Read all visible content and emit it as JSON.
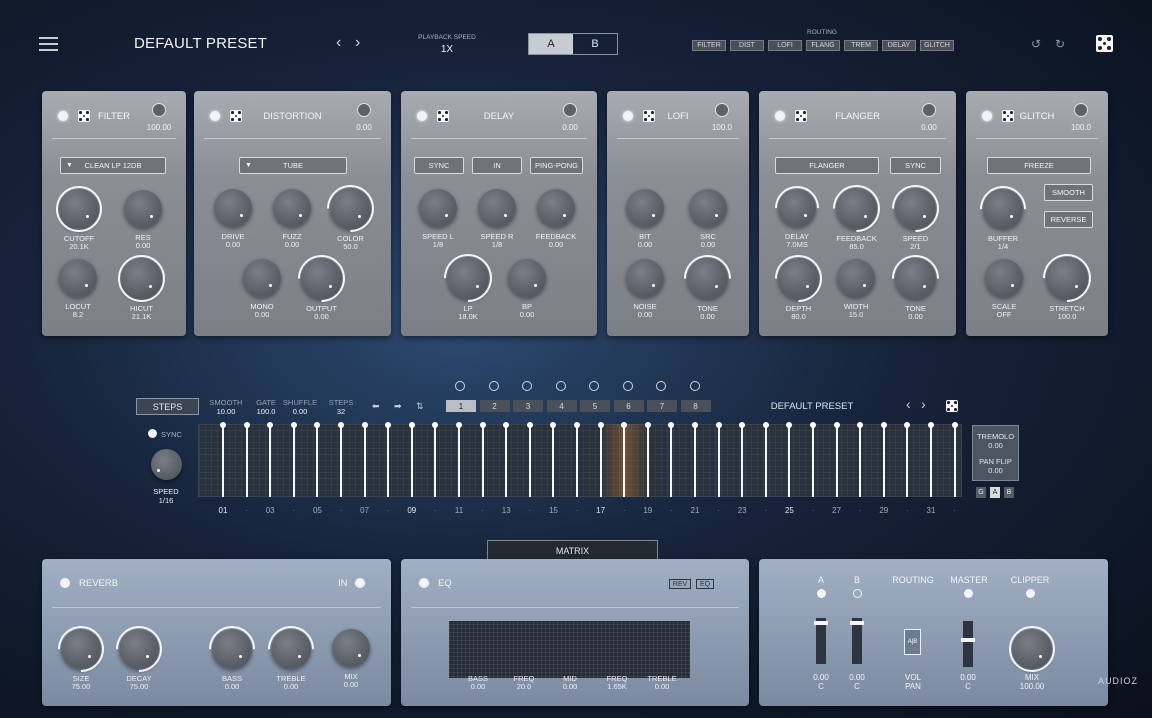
{
  "header": {
    "title": "DEFAULT PRESET",
    "playback_label": "PLAYBACK SPEED",
    "playback_value": "1X",
    "ab": [
      "A",
      "B"
    ],
    "routing_label": "ROUTING",
    "routing": [
      "FILTER",
      "DIST",
      "LOFI",
      "FLANG",
      "TREM",
      "DELAY",
      "GLITCH"
    ]
  },
  "filter": {
    "name": "FILTER",
    "mini": "100.00",
    "dropdown": "CLEAN LP 12DB",
    "knobs": [
      {
        "l": "CUTOFF",
        "v": "20.1K"
      },
      {
        "l": "RES",
        "v": "0.00"
      },
      {
        "l": "LOCUT",
        "v": "8.2"
      },
      {
        "l": "HICUT",
        "v": "21.1K"
      }
    ]
  },
  "distortion": {
    "name": "DISTORTION",
    "mini": "0.00",
    "dropdown": "TUBE",
    "knobs": [
      {
        "l": "DRIVE",
        "v": "0.00"
      },
      {
        "l": "FUZZ",
        "v": "0.00"
      },
      {
        "l": "COLOR",
        "v": "50.0"
      },
      {
        "l": "MONO",
        "v": "0.00"
      },
      {
        "l": "OUTPUT",
        "v": "0.00"
      }
    ]
  },
  "delay": {
    "name": "DELAY",
    "mini": "0.00",
    "buttons": [
      "SYNC",
      "IN",
      "PING-PONG"
    ],
    "knobs": [
      {
        "l": "SPEED L",
        "v": "1/8"
      },
      {
        "l": "SPEED R",
        "v": "1/8"
      },
      {
        "l": "FEEDBACK",
        "v": "0.00"
      },
      {
        "l": "LP",
        "v": "18.0K"
      },
      {
        "l": "BP",
        "v": "0.00"
      }
    ]
  },
  "lofi": {
    "name": "LOFI",
    "mini": "100.0",
    "knobs": [
      {
        "l": "BIT",
        "v": "0.00"
      },
      {
        "l": "SRC",
        "v": "0.00"
      },
      {
        "l": "NOISE",
        "v": "0.00"
      },
      {
        "l": "TONE",
        "v": "0.00"
      }
    ]
  },
  "flanger": {
    "name": "FLANGER",
    "mini": "0.00",
    "buttons": [
      "FLANGER",
      "SYNC"
    ],
    "knobs": [
      {
        "l": "DELAY",
        "v": "7.0MS"
      },
      {
        "l": "FEEDBACK",
        "v": "85.0"
      },
      {
        "l": "SPEED",
        "v": "2/1"
      },
      {
        "l": "DEPTH",
        "v": "80.0"
      },
      {
        "l": "WIDTH",
        "v": "15.0"
      },
      {
        "l": "TONE",
        "v": "0.00"
      }
    ]
  },
  "glitch": {
    "name": "GLITCH",
    "mini": "100.0",
    "buttons": [
      "FREEZE",
      "SMOOTH",
      "REVERSE"
    ],
    "knobs": [
      {
        "l": "BUFFER",
        "v": "1/4"
      },
      {
        "l": "SCALE",
        "v": "OFF"
      },
      {
        "l": "STRETCH",
        "v": "100.0"
      }
    ]
  },
  "seq": {
    "steps_btn": "STEPS",
    "params": [
      {
        "l": "SMOOTH",
        "v": "10.00"
      },
      {
        "l": "GATE",
        "v": "100.0"
      },
      {
        "l": "SHUFFLE",
        "v": "0.00"
      },
      {
        "l": "STEPS",
        "v": "32"
      }
    ],
    "pages": [
      "1",
      "2",
      "3",
      "4",
      "5",
      "6",
      "7",
      "8"
    ],
    "preset": "DEFAULT PRESET",
    "sync": "SYNC",
    "speed_label": "SPEED",
    "speed_value": "1/16",
    "step_labels": [
      "01",
      "03",
      "05",
      "07",
      "09",
      "11",
      "13",
      "15",
      "17",
      "19",
      "21",
      "23",
      "25",
      "27",
      "29",
      "31"
    ],
    "levels": [
      1,
      1,
      1,
      1,
      1,
      1,
      1,
      1,
      1,
      1,
      1,
      1,
      1,
      1,
      1,
      1,
      1,
      1,
      1,
      1,
      1,
      1,
      1,
      1,
      1,
      1,
      1,
      1,
      1,
      1,
      1,
      1
    ],
    "tremolo_label": "TREMOLO",
    "tremolo_value": "0.00",
    "panflip_label": "PAN FLIP",
    "panflip_value": "0.00",
    "gab": [
      "G",
      "A",
      "B"
    ]
  },
  "matrix": "MATRIX",
  "reverb": {
    "name": "REVERB",
    "in": "IN",
    "knobs": [
      {
        "l": "SIZE",
        "v": "75.00"
      },
      {
        "l": "DECAY",
        "v": "75.00"
      },
      {
        "l": "BASS",
        "v": "0.00"
      },
      {
        "l": "TREBLE",
        "v": "0.00"
      },
      {
        "l": "MIX",
        "v": "0.00"
      }
    ]
  },
  "eq": {
    "name": "EQ",
    "rev": "REV",
    "eq": "EQ",
    "bands": [
      {
        "l": "BASS",
        "v": "0.00"
      },
      {
        "l": "FREQ",
        "v": "20.0"
      },
      {
        "l": "MID",
        "v": "0.00"
      },
      {
        "l": "FREQ",
        "v": "1.65K"
      },
      {
        "l": "TREBLE",
        "v": "0.00"
      }
    ]
  },
  "master": {
    "a": "A",
    "b": "B",
    "routing": "ROUTING",
    "master": "MASTER",
    "clipper": "CLIPPER",
    "a_val": "0.00",
    "a_sub": "C",
    "b_val": "0.00",
    "b_sub": "C",
    "vol": "VOL",
    "pan": "PAN",
    "m_val": "0.00",
    "m_sub": "C",
    "mix": "MIX",
    "mix_val": "100.00",
    "ab_icon": "A|B"
  },
  "watermark": "AUDIOZ"
}
